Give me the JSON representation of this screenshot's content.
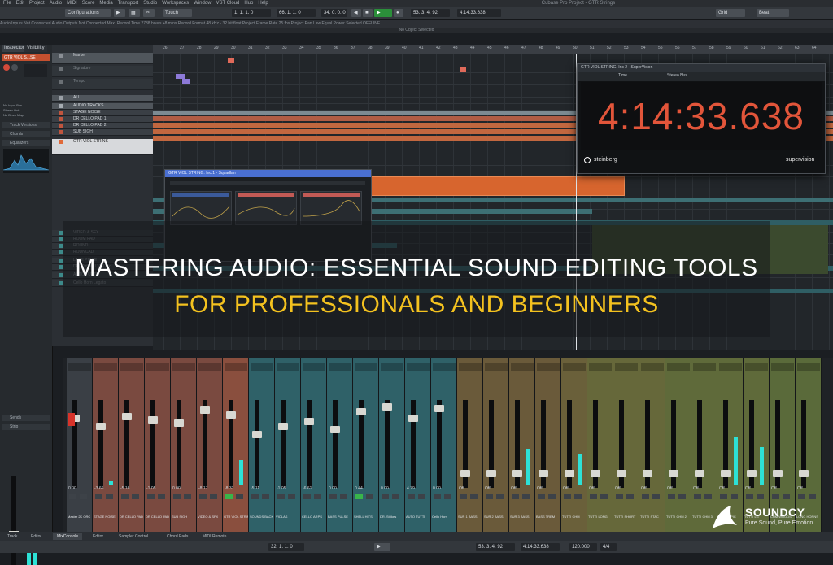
{
  "menu": [
    "File",
    "Edit",
    "Project",
    "Audio",
    "MIDI",
    "Score",
    "Media",
    "Transport",
    "Studio",
    "Workspaces",
    "Window",
    "VST Cloud",
    "Hub",
    "Help"
  ],
  "window_title": "Cubase Pro Project - GTR Strings",
  "toolbar": {
    "configurations": "Configurations",
    "touch": "Touch",
    "pos_left": "1. 1. 1. 0",
    "pos_mid": "66. 1. 1. 0",
    "pos_right": "34. 0. 0. 0",
    "bar_pos": "53. 3. 4. 92",
    "time_pos": "4:14:33.638",
    "grid": "Grid",
    "beat": "Beat"
  },
  "info_line": "Audio Inputs   Not Connected   Audio Outputs   Not Connected   Max. Record Time   2738 hours 48 mins   Record Format   48 kHz - 32 bit float   Project Frame Rate   25 fps   Project Pan Law   Equal Power   Selected   OFFLINE",
  "no_object": "No Object Selected",
  "left_zone": {
    "tabs": [
      "Inspector",
      "Visibility"
    ],
    "track_name": "GTR VIOL S...SE",
    "sections": [
      "Track Versions",
      "Chords",
      "Equalizers",
      "Inserts",
      "Sends",
      "Strip",
      "Notepad"
    ],
    "routing": [
      "No Input Bus",
      "Stereo Out",
      "No Drum Map"
    ]
  },
  "tracks": [
    {
      "name": "Marker",
      "kind": "folder",
      "color": "#8a8f95"
    },
    {
      "name": "Signature",
      "kind": "dim",
      "color": "#6b7075"
    },
    {
      "name": "Tempo",
      "kind": "dim",
      "color": "#6b7075"
    },
    {
      "name": "ALL",
      "kind": "folder",
      "color": "#9aa0a6"
    },
    {
      "name": "AUDIO TRACKS",
      "kind": "folder",
      "color": "#a6acb2"
    },
    {
      "name": "STAGE NOISE",
      "kind": "normal",
      "color": "#c0553e"
    },
    {
      "name": "DR CELLO PAD 1",
      "kind": "normal",
      "color": "#c0553e"
    },
    {
      "name": "DR CELLO PAD 2",
      "kind": "normal",
      "color": "#c0553e"
    },
    {
      "name": "SUB SIGH",
      "kind": "normal",
      "color": "#c0553e"
    },
    {
      "name": "GTR VIOL STRINS",
      "kind": "sel",
      "color": "#e06a3a"
    },
    {
      "name": "VIDEO & SFX",
      "kind": "dim",
      "color": "#3d8a8a"
    },
    {
      "name": "ROOM PAD",
      "kind": "dim",
      "color": "#3d8a8a"
    },
    {
      "name": "ROUND",
      "kind": "dim",
      "color": "#3d8a8a"
    },
    {
      "name": "ROUNCAD",
      "kind": "dim",
      "color": "#3d8a8a"
    },
    {
      "name": "LASE PIECE",
      "kind": "dim",
      "color": "#3d8a8a"
    },
    {
      "name": "DR. Strikes / Viol. ext",
      "kind": "dim",
      "color": "#3d8a8a"
    },
    {
      "name": "AUTO TUTTI",
      "kind": "dim",
      "color": "#3d8a8a"
    },
    {
      "name": "Cello Horn Legato",
      "kind": "dim",
      "color": "#3d8a8a"
    }
  ],
  "ruler": [
    "26",
    "27",
    "28",
    "29",
    "30",
    "31",
    "32",
    "33",
    "34",
    "35",
    "36",
    "37",
    "38",
    "39",
    "40",
    "41",
    "42",
    "43",
    "44",
    "45",
    "46",
    "47",
    "48",
    "49",
    "50",
    "51",
    "52",
    "53",
    "54",
    "55",
    "56",
    "57",
    "58",
    "59",
    "60",
    "61",
    "62",
    "63",
    "64"
  ],
  "supervision": {
    "title": "GTR VIOL STRING. Inc 2 - SuperVision",
    "mode": "Time",
    "bus": "Stereo Bus",
    "time": "4:14:33.638",
    "brand": "steinberg",
    "product": "supervision"
  },
  "squad_window": {
    "title": "GTR VIOL STRING. Inc 1 - Squadlan"
  },
  "headline": {
    "line1": "MASTERING AUDIO: ESSENTIAL SOUND EDITING TOOLS",
    "line2": "FOR PROFESSIONALS AND BEGINNERS"
  },
  "mixer": {
    "values": [
      "0.00",
      "-3.66",
      "-5.16",
      "-1.05",
      "0.00",
      "-8.17",
      "-8.31",
      "-5.11",
      "-1.05",
      "-6.61",
      "0.00",
      "0.44",
      "0.00",
      "4.79",
      "0.00",
      "Off",
      "Off",
      "Off",
      "Off",
      "Off",
      "Off",
      "Off",
      "Off",
      "Off",
      "Off",
      "Off",
      "Off",
      "Off",
      "Off"
    ],
    "names": [
      "Master 2K ORC",
      "STAGE NOISE",
      "DR CELLO PAD 1",
      "DR CELLO PAD 2",
      "SUB SIGH",
      "VIDEO & SFX",
      "GTR VIOL STRIN",
      "SOUNDS BACK",
      "VIOLAS",
      "CELLO ARPS",
      "BASS PULSE",
      "SHELL HITS",
      "DR. Strikes",
      "AUTO TUTTI",
      "Cello Horn",
      "SUR 1 BASS",
      "SUR 2 BASS",
      "SUR 3 BASS",
      "BASS TREM",
      "TUTTI CHM",
      "TUTTI LONG",
      "TUTTI SHORT",
      "TUTTI STAC",
      "TUTTI CHM 2",
      "TUTTI CHM 3",
      "TUTTI SPIC",
      "TUTTI LG",
      "CHM WOODS",
      "LONG HORNS"
    ],
    "colors": [
      "#3a3f45",
      "#7a4a40",
      "#7a4a40",
      "#7a4a40",
      "#7a4a40",
      "#7a4a40",
      "#8a4f3e",
      "#2f6168",
      "#2f6168",
      "#2f6168",
      "#2f6168",
      "#2f6168",
      "#2f6168",
      "#2f6168",
      "#2f6168",
      "#6a5a3a",
      "#6a5a3a",
      "#6a5a3a",
      "#6a5a3a",
      "#6a603a",
      "#66683a",
      "#66683a",
      "#66683a",
      "#5f6a3a",
      "#5f6a3a",
      "#5f6a3a",
      "#5f6a3a",
      "#5a6a3a",
      "#5a6a3a"
    ]
  },
  "bottom_tabs": [
    "Track",
    "Editor",
    "MixConsole",
    "Editor",
    "Sampler Control",
    "Chord Pads",
    "MIDI Remote"
  ],
  "transport": {
    "left": "32. 1. 1. 0",
    "right": "53. 3. 4. 92",
    "time": "4:14:33.638",
    "tempo": "120.000",
    "sig": "4/4"
  },
  "logo": {
    "name": "SOUNDCY",
    "tagline": "Pure Sound, Pure Emotion"
  }
}
